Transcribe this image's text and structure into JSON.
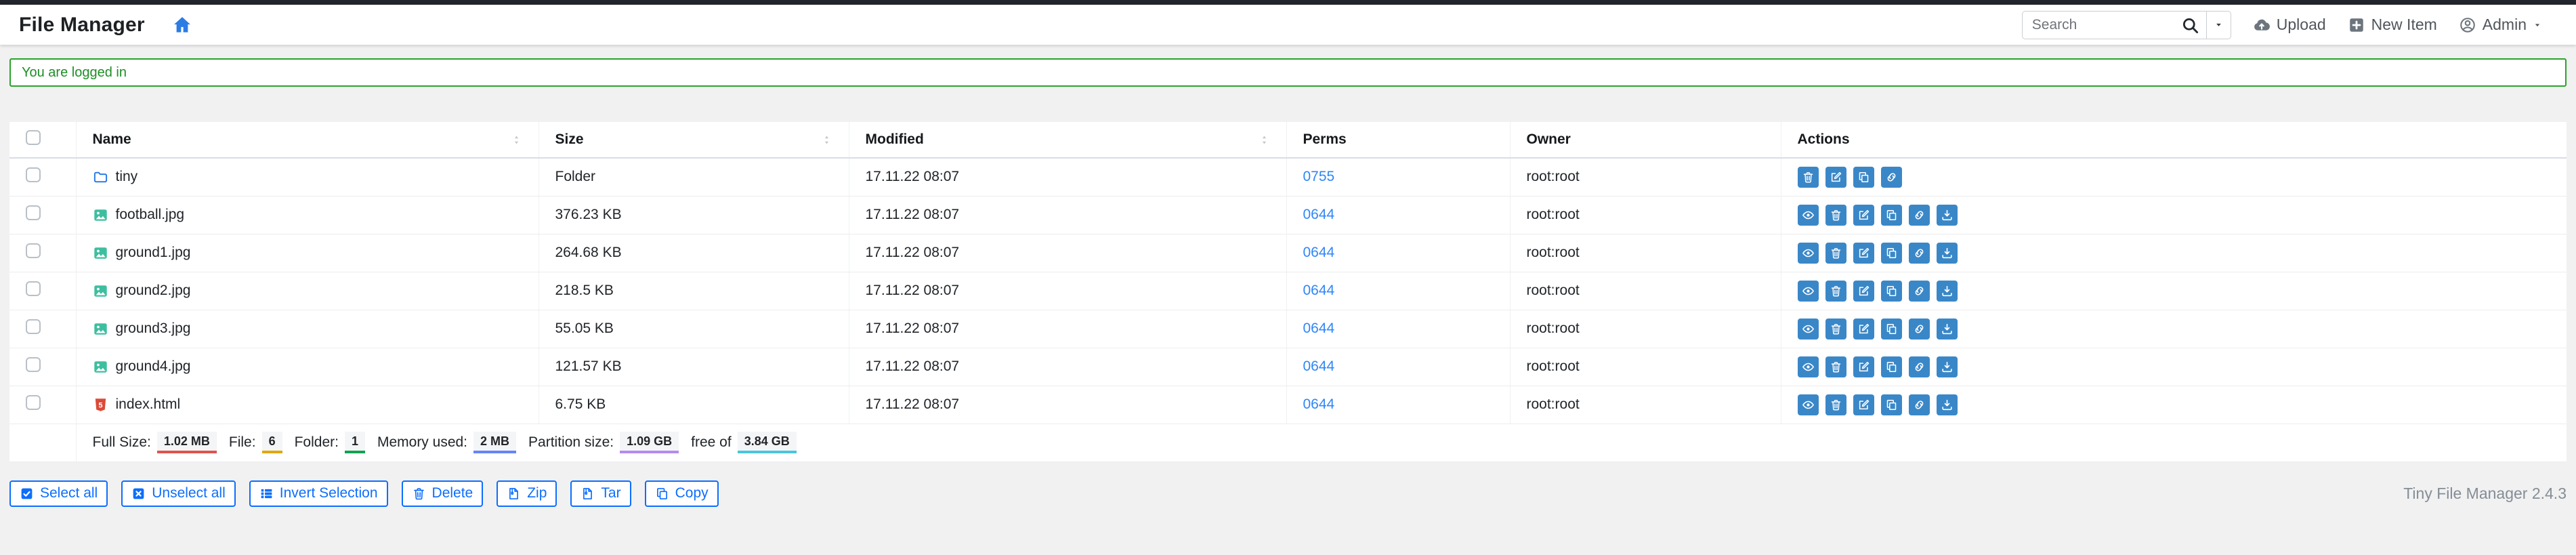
{
  "nav": {
    "title": "File Manager",
    "search_placeholder": "Search",
    "items": [
      {
        "label": "Upload",
        "icon": "cloud-upload-icon"
      },
      {
        "label": "New Item",
        "icon": "plus-square-icon"
      },
      {
        "label": "Admin",
        "icon": "person-circle-icon",
        "caret": true
      }
    ]
  },
  "alert": {
    "message": "You are logged in"
  },
  "table": {
    "headers": [
      {
        "label": "Name",
        "sortable": true
      },
      {
        "label": "Size",
        "sortable": true
      },
      {
        "label": "Modified",
        "sortable": true
      },
      {
        "label": "Perms",
        "sortable": false
      },
      {
        "label": "Owner",
        "sortable": false
      },
      {
        "label": "Actions",
        "sortable": false
      }
    ],
    "rows": [
      {
        "name": "tiny",
        "icon": "folder-icon",
        "size": "Folder",
        "modified": "17.11.22 08:07",
        "perms": "0755",
        "owner": "root:root",
        "actions": [
          "delete",
          "rename",
          "copy",
          "link"
        ]
      },
      {
        "name": "football.jpg",
        "icon": "image-icon",
        "size": "376.23 KB",
        "modified": "17.11.22 08:07",
        "perms": "0644",
        "owner": "root:root",
        "actions": [
          "preview",
          "delete",
          "rename",
          "copy",
          "link",
          "download"
        ]
      },
      {
        "name": "ground1.jpg",
        "icon": "image-icon",
        "size": "264.68 KB",
        "modified": "17.11.22 08:07",
        "perms": "0644",
        "owner": "root:root",
        "actions": [
          "preview",
          "delete",
          "rename",
          "copy",
          "link",
          "download"
        ]
      },
      {
        "name": "ground2.jpg",
        "icon": "image-icon",
        "size": "218.5 KB",
        "modified": "17.11.22 08:07",
        "perms": "0644",
        "owner": "root:root",
        "actions": [
          "preview",
          "delete",
          "rename",
          "copy",
          "link",
          "download"
        ]
      },
      {
        "name": "ground3.jpg",
        "icon": "image-icon",
        "size": "55.05 KB",
        "modified": "17.11.22 08:07",
        "perms": "0644",
        "owner": "root:root",
        "actions": [
          "preview",
          "delete",
          "rename",
          "copy",
          "link",
          "download"
        ]
      },
      {
        "name": "ground4.jpg",
        "icon": "image-icon",
        "size": "121.57 KB",
        "modified": "17.11.22 08:07",
        "perms": "0644",
        "owner": "root:root",
        "actions": [
          "preview",
          "delete",
          "rename",
          "copy",
          "link",
          "download"
        ]
      },
      {
        "name": "index.html",
        "icon": "html-icon",
        "size": "6.75 KB",
        "modified": "17.11.22 08:07",
        "perms": "0644",
        "owner": "root:root",
        "actions": [
          "preview",
          "delete",
          "rename",
          "copy",
          "link",
          "download"
        ]
      }
    ],
    "summary": [
      {
        "label": "Full Size:",
        "value": "1.02 MB",
        "color": "#e0534e"
      },
      {
        "label": "File:",
        "value": "6",
        "color": "#e0a80b"
      },
      {
        "label": "Folder:",
        "value": "1",
        "color": "#12a151"
      },
      {
        "label": "Memory used:",
        "value": "2 MB",
        "color": "#6584fa"
      },
      {
        "label": "Partition size:",
        "value": "1.09 GB",
        "color": "#b58af2"
      },
      {
        "label": "free of",
        "value": "3.84 GB",
        "color": "#49c6dd"
      }
    ]
  },
  "toolbar": {
    "buttons": [
      {
        "label": "Select all",
        "icon": "check-square-icon"
      },
      {
        "label": "Unselect all",
        "icon": "x-square-icon"
      },
      {
        "label": "Invert Selection",
        "icon": "list-icon"
      },
      {
        "label": "Delete",
        "icon": "trash-icon"
      },
      {
        "label": "Zip",
        "icon": "file-zip-icon"
      },
      {
        "label": "Tar",
        "icon": "file-zip-icon"
      },
      {
        "label": "Copy",
        "icon": "copy-icon"
      }
    ]
  },
  "footer": {
    "version": "Tiny File Manager 2.4.3"
  },
  "colors": {
    "action_button_blue": "#3a87c8",
    "outline_button_blue": "#0d6efd",
    "perms_link_blue": "#2f86f5",
    "alert_green_border": "#2ba32b",
    "alert_green_text": "#1e8e27",
    "folder_icon_blue": "#2b7ce5",
    "image_icon_teal": "#3dbf9f",
    "html_icon_red": "#dc4a38",
    "topstrip_dark": "#22262c"
  }
}
